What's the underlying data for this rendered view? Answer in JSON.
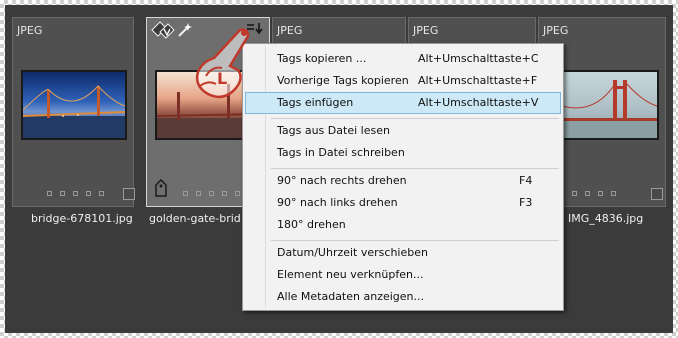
{
  "tiles": [
    {
      "format": "JPEG",
      "filename": "bridge-678101.jpg",
      "selected": false
    },
    {
      "format": "",
      "filename": "golden-gate-brid",
      "selected": true
    },
    {
      "format": "JPEG",
      "filename": "",
      "selected": false
    },
    {
      "format": "JPEG",
      "filename": "",
      "selected": false
    },
    {
      "format": "JPEG",
      "filename": "IMG_4836.jpg",
      "selected": false
    }
  ],
  "hover_icons": {
    "tags": "tags-icon",
    "magic": "magic-wand-icon",
    "menu": "tag-menu-icon"
  },
  "pointer_label": "L",
  "menu": {
    "items": [
      {
        "label": "Tags kopieren ...",
        "shortcut": "Alt+Umschalttaste+C"
      },
      {
        "label": "Vorherige Tags kopieren",
        "shortcut": "Alt+Umschalttaste+F"
      },
      {
        "label": "Tags einfügen",
        "shortcut": "Alt+Umschalttaste+V",
        "highlighted": true
      },
      {
        "label": "Tags aus Datei lesen",
        "shortcut": ""
      },
      {
        "label": "Tags in Datei schreiben",
        "shortcut": ""
      },
      {
        "label": "90° nach rechts drehen",
        "shortcut": "F4"
      },
      {
        "label": "90° nach links drehen",
        "shortcut": "F3"
      },
      {
        "label": "180° drehen",
        "shortcut": ""
      },
      {
        "label": "Datum/Uhrzeit verschieben",
        "shortcut": ""
      },
      {
        "label": "Element neu verknüpfen...",
        "shortcut": ""
      },
      {
        "label": "Alle Metadaten anzeigen...",
        "shortcut": ""
      }
    ]
  },
  "colors": {
    "highlight": "#cde8f6",
    "panel": "#3b3b3b",
    "selected_tile": "#6e6e6e",
    "pointer": "#c0392b"
  }
}
